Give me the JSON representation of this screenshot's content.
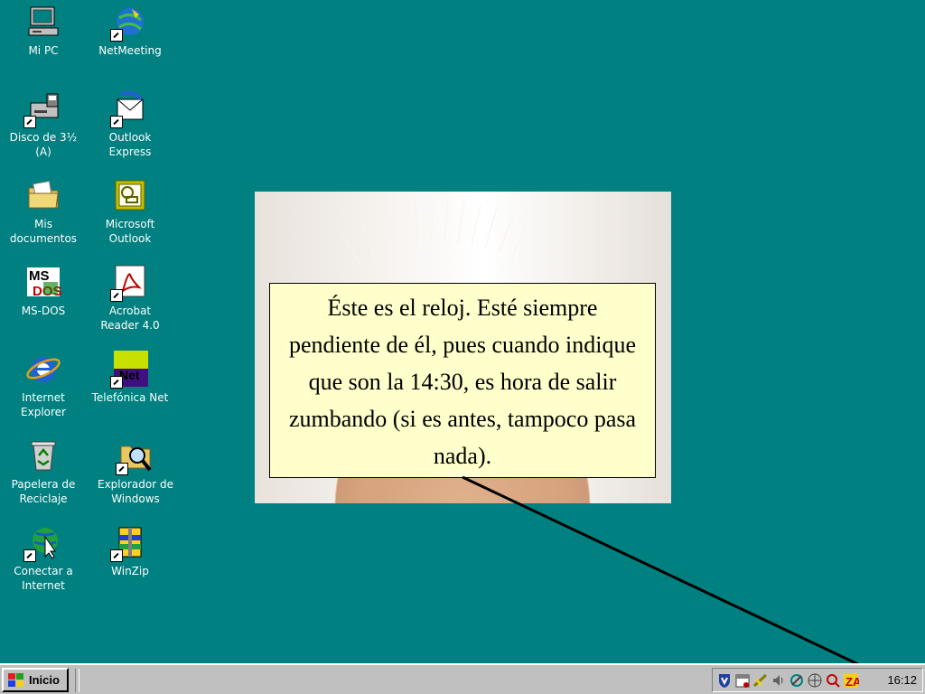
{
  "desktop": {
    "icons": [
      {
        "label": "Mi PC",
        "name": "mi-pc-icon"
      },
      {
        "label": "NetMeeting",
        "name": "netmeeting-icon"
      },
      {
        "label": "Disco de 3½\n(A)",
        "name": "floppy-disk-icon"
      },
      {
        "label": "Outlook\nExpress",
        "name": "outlook-express-icon"
      },
      {
        "label": "Mis\ndocumentos",
        "name": "folder-documents-icon"
      },
      {
        "label": "Microsoft\nOutlook",
        "name": "microsoft-outlook-icon"
      },
      {
        "label": "MS-DOS",
        "name": "ms-dos-icon"
      },
      {
        "label": "Acrobat\nReader 4.0",
        "name": "acrobat-reader-icon"
      },
      {
        "label": "Internet\nExplorer",
        "name": "internet-explorer-icon"
      },
      {
        "label": "Telefónica Net",
        "name": "telefonica-net-icon"
      },
      {
        "label": "Papelera de\nReciclaje",
        "name": "recycle-bin-icon"
      },
      {
        "label": "Explorador de\nWindows",
        "name": "windows-explorer-icon"
      },
      {
        "label": "Conectar a\nInternet",
        "name": "connect-internet-icon"
      },
      {
        "label": "WinZip",
        "name": "winzip-icon"
      }
    ]
  },
  "callout": {
    "text": "Éste es el reloj. Esté siempre pendiente de él, pues cuando indique que son la 14:30, es hora de salir zumbando (si es antes, tampoco pasa nada)."
  },
  "taskbar": {
    "start_label": "Inicio",
    "clock": "16:12",
    "tray_icons": [
      "shield-icon",
      "calendar-icon",
      "network-icon",
      "speaker-icon",
      "tool-icon",
      "globe-icon",
      "antivirus-icon",
      "zonealarm-icon"
    ]
  },
  "colors": {
    "desktop": "#008080",
    "taskbar": "#c0c0c0",
    "callout_bg": "#ffffcc"
  }
}
